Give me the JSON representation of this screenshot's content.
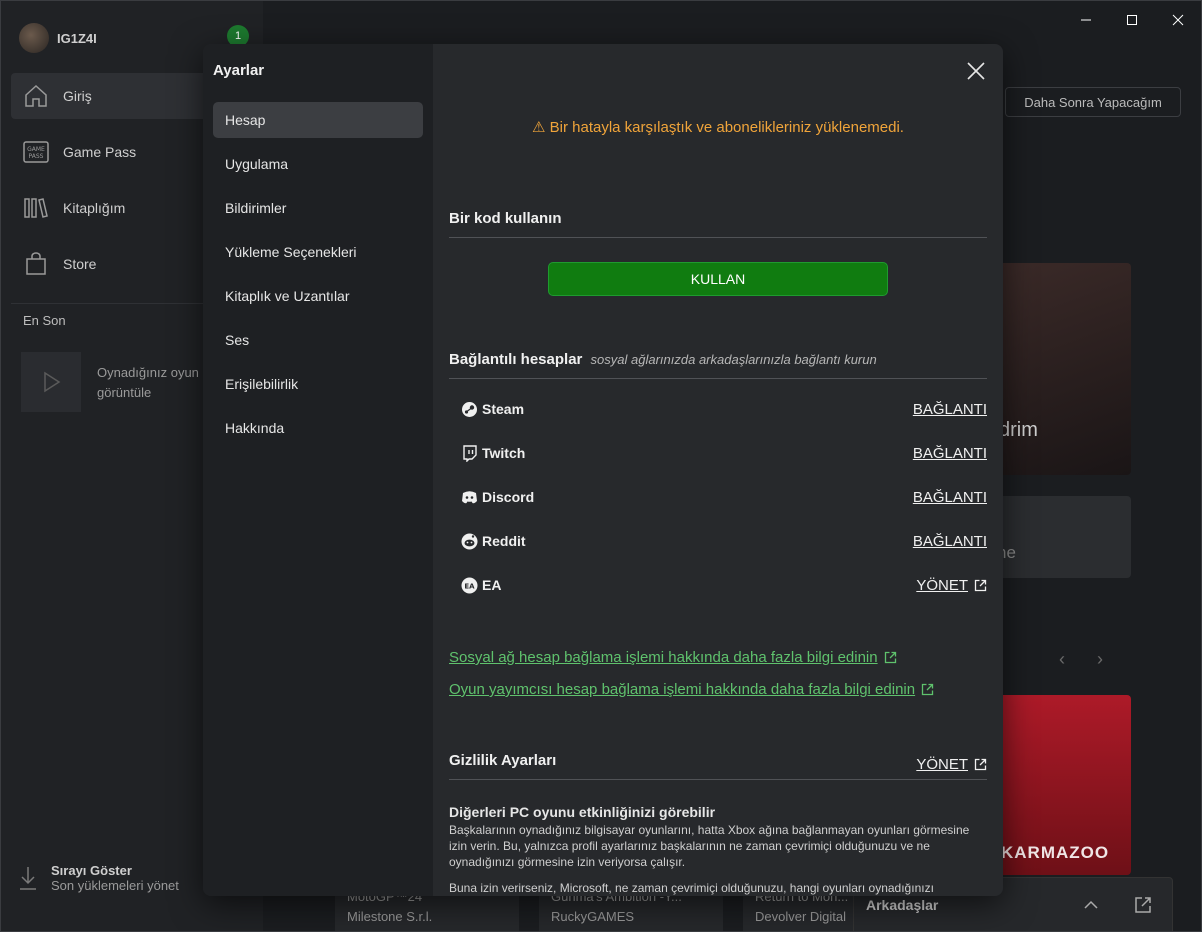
{
  "app": {
    "gamertag": "IG1Z4I",
    "notification_count": "1",
    "nav": [
      {
        "label": "Giriş",
        "icon": "home-icon"
      },
      {
        "label": "Game Pass",
        "icon": "game-pass-icon"
      },
      {
        "label": "Kitaplığım",
        "icon": "library-icon"
      },
      {
        "label": "Store",
        "icon": "store-icon"
      }
    ],
    "recent_label": "En Son",
    "recent_text": "Oynadığınız oyun burada görüntüle",
    "queue_title": "Sırayı Göster",
    "queue_sub": "Son yüklemeleri yönet",
    "later_button": "Daha Sonra Yapacağım",
    "hero_text": "drim",
    "tile2_text": "ne",
    "tile3_text": "KARMAZOO",
    "bottom_cards": [
      {
        "title": "MotoGP™24",
        "sub": "Milestone S.r.l."
      },
      {
        "title": "Gunma's Ambition -Y...",
        "sub": "RuckyGAMES"
      },
      {
        "title": "Return to Mon...",
        "sub": "Devolver Digital"
      }
    ],
    "friends_label": "Arkadaşlar"
  },
  "settings": {
    "title": "Ayarlar",
    "menu": [
      "Hesap",
      "Uygulama",
      "Bildirimler",
      "Yükleme Seçenekleri",
      "Kitaplık ve Uzantılar",
      "Ses",
      "Erişilebilirlik",
      "Hakkında"
    ],
    "error_text": "Bir hatayla karşılaştık ve abonelikleriniz yüklenemedi.",
    "redeem": {
      "heading": "Bir kod kullanın",
      "button": "KULLAN"
    },
    "linked": {
      "heading": "Bağlantılı hesaplar",
      "subheading": "sosyal ağlarınızda arkadaşlarınızla bağlantı kurun",
      "accounts": [
        {
          "name": "Steam",
          "action": "BAĞLANTI",
          "icon": "steam-icon"
        },
        {
          "name": "Twitch",
          "action": "BAĞLANTI",
          "icon": "twitch-icon"
        },
        {
          "name": "Discord",
          "action": "BAĞLANTI",
          "icon": "discord-icon"
        },
        {
          "name": "Reddit",
          "action": "BAĞLANTI",
          "icon": "reddit-icon"
        },
        {
          "name": "EA",
          "action": "YÖNET",
          "icon": "ea-icon"
        }
      ]
    },
    "links": [
      "Sosyal ağ hesap bağlama işlemi hakkında daha fazla bilgi edinin",
      "Oyun yayımcısı hesap bağlama işlemi hakkında daha fazla bilgi edinin"
    ],
    "privacy": {
      "heading": "Gizlilik Ayarları",
      "manage": "YÖNET",
      "item_title": "Diğerleri PC oyunu etkinliğinizi görebilir",
      "item_desc": "Başkalarının oynadığınız bilgisayar oyunlarını, hatta Xbox ağına bağlanmayan oyunları görmesine izin verin. Bu, yalnızca profil ayarlarınız başkalarının ne zaman çevrimiçi olduğunuzu ve ne oynadığınızı görmesine izin veriyorsa çalışır.",
      "item_desc2": "Buna izin verirseniz, Microsoft, ne zaman çevrimiçi olduğunuzu, hangi oyunları oynadığınızı"
    }
  },
  "colors": {
    "accent_green": "#107c10",
    "link_green": "#5fc26d",
    "warning": "#f0a43a"
  }
}
